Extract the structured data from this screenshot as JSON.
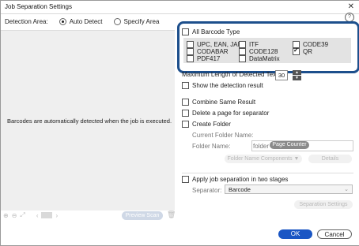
{
  "window": {
    "title": "Job Separation Settings",
    "close": "✕",
    "help": "?"
  },
  "detection": {
    "label": "Detection Area:",
    "auto": "Auto Detect",
    "specify": "Specify Area",
    "selected": "auto"
  },
  "left": {
    "message": "Barcodes are automatically detected when the job is executed.",
    "preview_button": "Preview Scan",
    "tools": [
      "zoom-in-icon",
      "zoom-out-icon",
      "fit-icon",
      "page-prev-icon",
      "page-next-icon",
      "trash-icon"
    ]
  },
  "barcode": {
    "all_label": "All Barcode Type",
    "types": [
      {
        "label": "UPC, EAN, JAN",
        "checked": false
      },
      {
        "label": "ITF",
        "checked": false
      },
      {
        "label": "CODE39",
        "checked": false
      },
      {
        "label": "CODABAR",
        "checked": false
      },
      {
        "label": "CODE128",
        "checked": false
      },
      {
        "label": "QR",
        "checked": true
      },
      {
        "label": "PDF417",
        "checked": false
      },
      {
        "label": "DataMatrix",
        "checked": false
      }
    ]
  },
  "max_length": {
    "label": "Maximum Length of Detected Text:",
    "value": "30"
  },
  "options": {
    "show_result": "Show the detection result",
    "combine": "Combine Same Result",
    "delete_page": "Delete a page for separator",
    "create_folder": "Create Folder"
  },
  "folder": {
    "current_label": "Current Folder Name:",
    "name_label": "Folder Name:",
    "name_prefix": "folder",
    "name_tag": "Page Counter",
    "components_button": "Folder Name Components ▼",
    "details_button": "Details"
  },
  "two_stage": {
    "label": "Apply job separation in two stages",
    "separator_label": "Separator:",
    "separator_value": "Barcode",
    "settings_button": "Separation Settings"
  },
  "footer": {
    "ok": "OK",
    "cancel": "Cancel"
  },
  "colors": {
    "accent": "#1a56c4",
    "highlight_border": "#1d4f8c"
  }
}
